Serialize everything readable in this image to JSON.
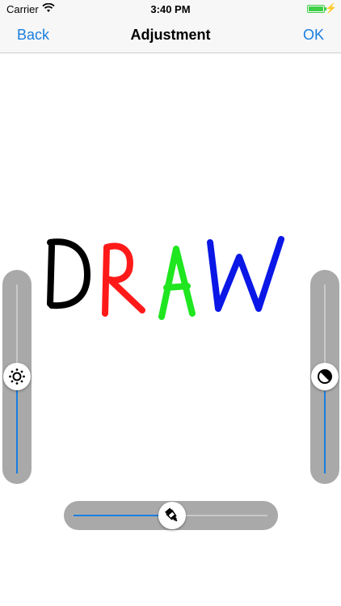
{
  "status_bar": {
    "carrier": "Carrier",
    "time": "3:40 PM"
  },
  "nav": {
    "back_label": "Back",
    "title": "Adjustment",
    "ok_label": "OK"
  },
  "drawing": {
    "letters": [
      {
        "char": "D",
        "color": "#000000"
      },
      {
        "char": "R",
        "color": "#ff1a1a"
      },
      {
        "char": "A",
        "color": "#1fe61f"
      },
      {
        "char": "W",
        "color": "#0a17e6"
      }
    ]
  },
  "sliders": {
    "brightness": {
      "icon": "brightness-icon",
      "value_fraction": 0.47
    },
    "contrast": {
      "icon": "contrast-icon",
      "value_fraction": 0.45
    },
    "saturation": {
      "icon": "paint-tube-icon",
      "value_fraction": 0.5
    }
  },
  "colors": {
    "accent": "#1a7ee0",
    "slider_bg": "#a9a9a9",
    "battery": "#3ecf47"
  }
}
